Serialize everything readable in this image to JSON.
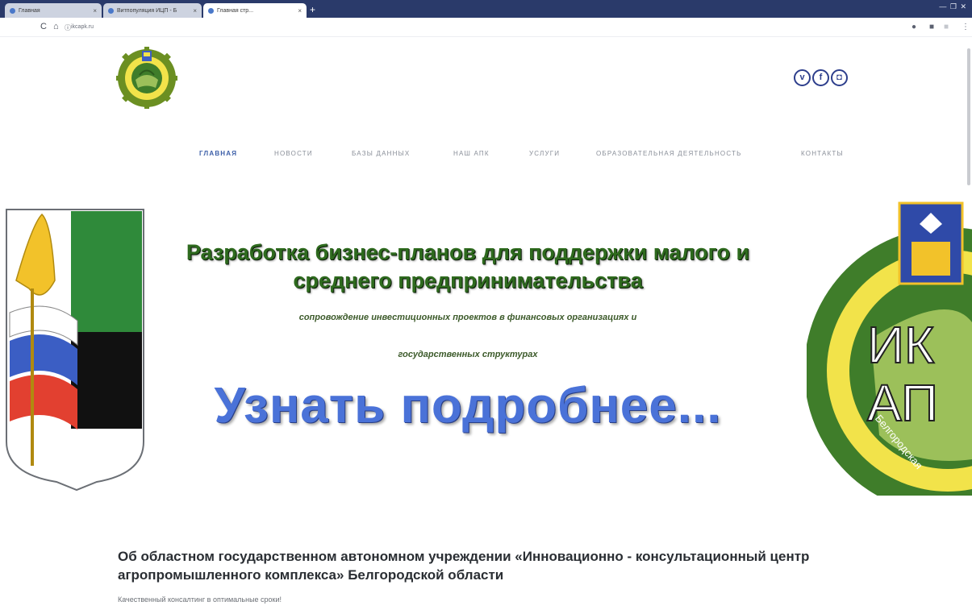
{
  "browser": {
    "tabs": [
      {
        "label": "Главная"
      },
      {
        "label": "Bитпопуляция ИЦП - Б"
      },
      {
        "label": "Главная стр..."
      }
    ],
    "url": "ikcapk.ru",
    "new_tab_icon": "plus-icon",
    "window_controls": "— ❐ ✕"
  },
  "header": {
    "logo_alt": "ИКЦ АПК Белгородской области",
    "socials": [
      {
        "name": "vk-icon",
        "glyph": "v"
      },
      {
        "name": "facebook-icon",
        "glyph": "f"
      },
      {
        "name": "instagram-icon",
        "glyph": "◘"
      }
    ]
  },
  "nav": {
    "items": [
      {
        "label": "ГЛАВНАЯ",
        "active": true
      },
      {
        "label": "НОВОСТИ"
      },
      {
        "label": "БАЗЫ ДАННЫХ"
      },
      {
        "label": "НАШ АПК"
      },
      {
        "label": "УСЛУГИ"
      },
      {
        "label": "ОБРАЗОВАТЕЛЬНАЯ ДЕЯТЕЛЬНОСТЬ"
      },
      {
        "label": "КОНТАКТЫ"
      }
    ]
  },
  "hero": {
    "title_line1": "Разработка бизнес-планов для поддержки малого и",
    "title_line2": "среднего предпринимательства",
    "subtitle_line1": "сопровождение инвестиционных проектов в финансовых организациях и",
    "subtitle_line2": "государственных структурах",
    "cta": "Узнать подробнее...",
    "emblem_right_text": [
      "ИК",
      "АП"
    ],
    "emblem_right_ring_text": "Белгородская"
  },
  "about": {
    "title": "Об областном государственном автономном учреждении «Инновационно - консультационный центр агропромышленного комплекса» Белгородской области",
    "text": "Качественный консалтинг в оптимальные сроки!"
  },
  "colors": {
    "accent_blue": "#3b5ea8",
    "cta_blue": "#4a72d8",
    "title_green": "#2e6a1e"
  }
}
